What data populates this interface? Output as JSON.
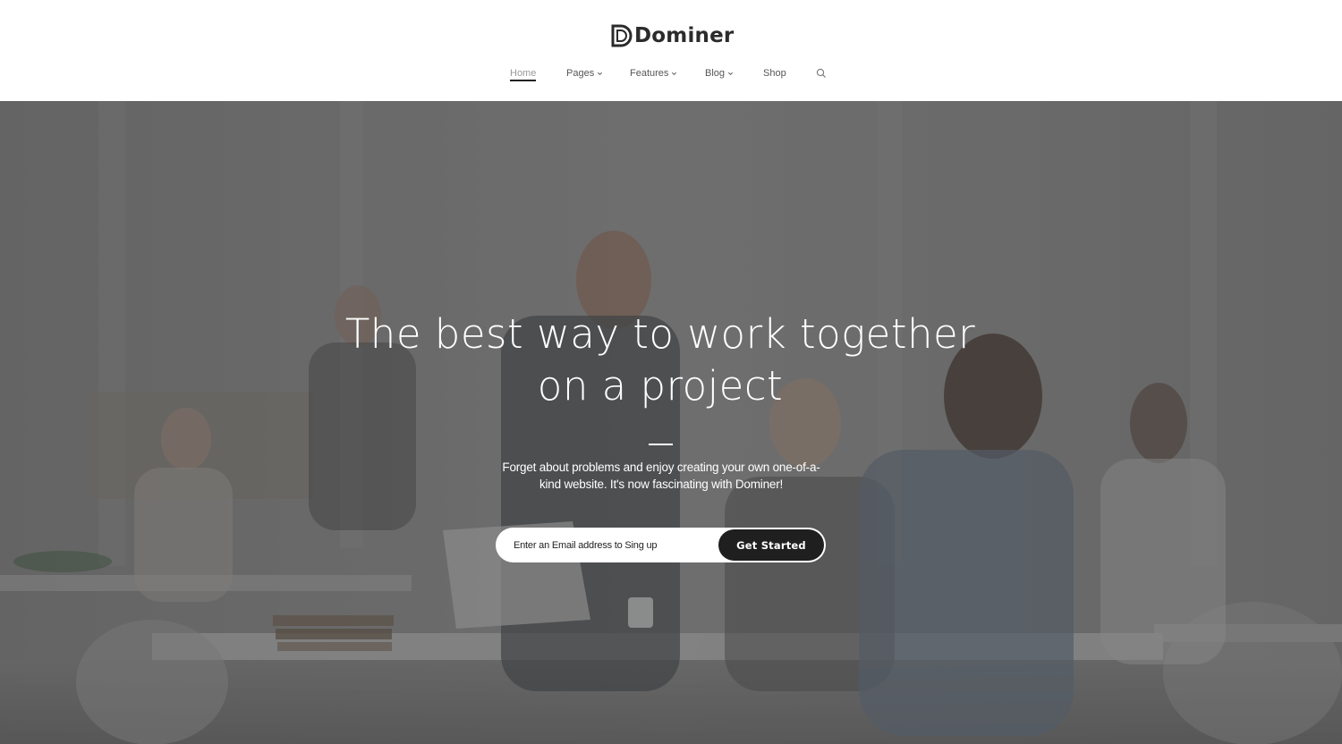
{
  "brand": {
    "name": "Dominer",
    "logo_icon": "d-monogram-icon"
  },
  "nav": {
    "items": [
      {
        "label": "Home",
        "active": true,
        "has_dropdown": false
      },
      {
        "label": "Pages",
        "active": false,
        "has_dropdown": true
      },
      {
        "label": "Features",
        "active": false,
        "has_dropdown": true
      },
      {
        "label": "Blog",
        "active": false,
        "has_dropdown": true
      },
      {
        "label": "Shop",
        "active": false,
        "has_dropdown": false
      }
    ],
    "search_icon": "search-icon"
  },
  "hero": {
    "title_line1": "The best way to work together",
    "title_line2": "on a project",
    "subtitle_line1": "Forget about problems and enjoy creating your own one-of-a-",
    "subtitle_line2": "kind website. It's now fascinating with Dominer!",
    "email_placeholder": "Enter an Email address to Sing up",
    "cta_label": "Get Started"
  },
  "colors": {
    "header_bg": "#ffffff",
    "text_dark": "#2b2b2b",
    "button_bg": "#1f1f1f",
    "hero_text": "#ffffff"
  }
}
